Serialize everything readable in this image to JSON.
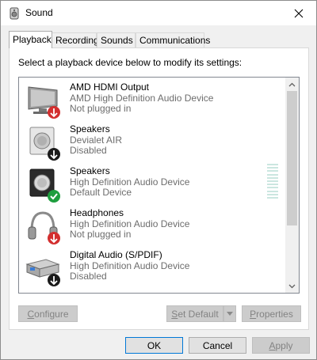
{
  "window": {
    "title": "Sound"
  },
  "tabs": [
    {
      "label": "Playback",
      "active": true
    },
    {
      "label": "Recording",
      "active": false
    },
    {
      "label": "Sounds",
      "active": false
    },
    {
      "label": "Communications",
      "active": false
    }
  ],
  "panel": {
    "instruction": "Select a playback device below to modify its settings:"
  },
  "devices": [
    {
      "name": "AMD HDMI Output",
      "description": "AMD High Definition Audio Device",
      "status": "Not plugged in",
      "icon": "monitor-icon",
      "badge": "red-down-arrow"
    },
    {
      "name": "Speakers",
      "description": "Devialet AIR",
      "status": "Disabled",
      "icon": "speaker-icon",
      "badge": "black-down-arrow"
    },
    {
      "name": "Speakers",
      "description": "High Definition Audio Device",
      "status": "Default Device",
      "icon": "speaker-icon",
      "badge": "green-check"
    },
    {
      "name": "Headphones",
      "description": "High Definition Audio Device",
      "status": "Not plugged in",
      "icon": "headphones-icon",
      "badge": "red-down-arrow"
    },
    {
      "name": "Digital Audio (S/PDIF)",
      "description": "High Definition Audio Device",
      "status": "Disabled",
      "icon": "digital-audio-icon",
      "badge": "black-down-arrow"
    }
  ],
  "buttons": {
    "configure": {
      "label_pre": "",
      "label_underline": "C",
      "label_post": "onfigure"
    },
    "set_default": {
      "label_pre": "",
      "label_underline": "S",
      "label_post": "et Default"
    },
    "properties": {
      "label_pre": "",
      "label_underline": "P",
      "label_post": "roperties"
    },
    "ok": "OK",
    "cancel": "Cancel",
    "apply": {
      "label_pre": "",
      "label_underline": "A",
      "label_post": "pply"
    }
  },
  "colors": {
    "accent": "#0078d7",
    "badge_red": "#d32f2f",
    "badge_green": "#1e9e3e",
    "disabled_text": "#838383",
    "secondary_text": "#6d6d6d"
  }
}
